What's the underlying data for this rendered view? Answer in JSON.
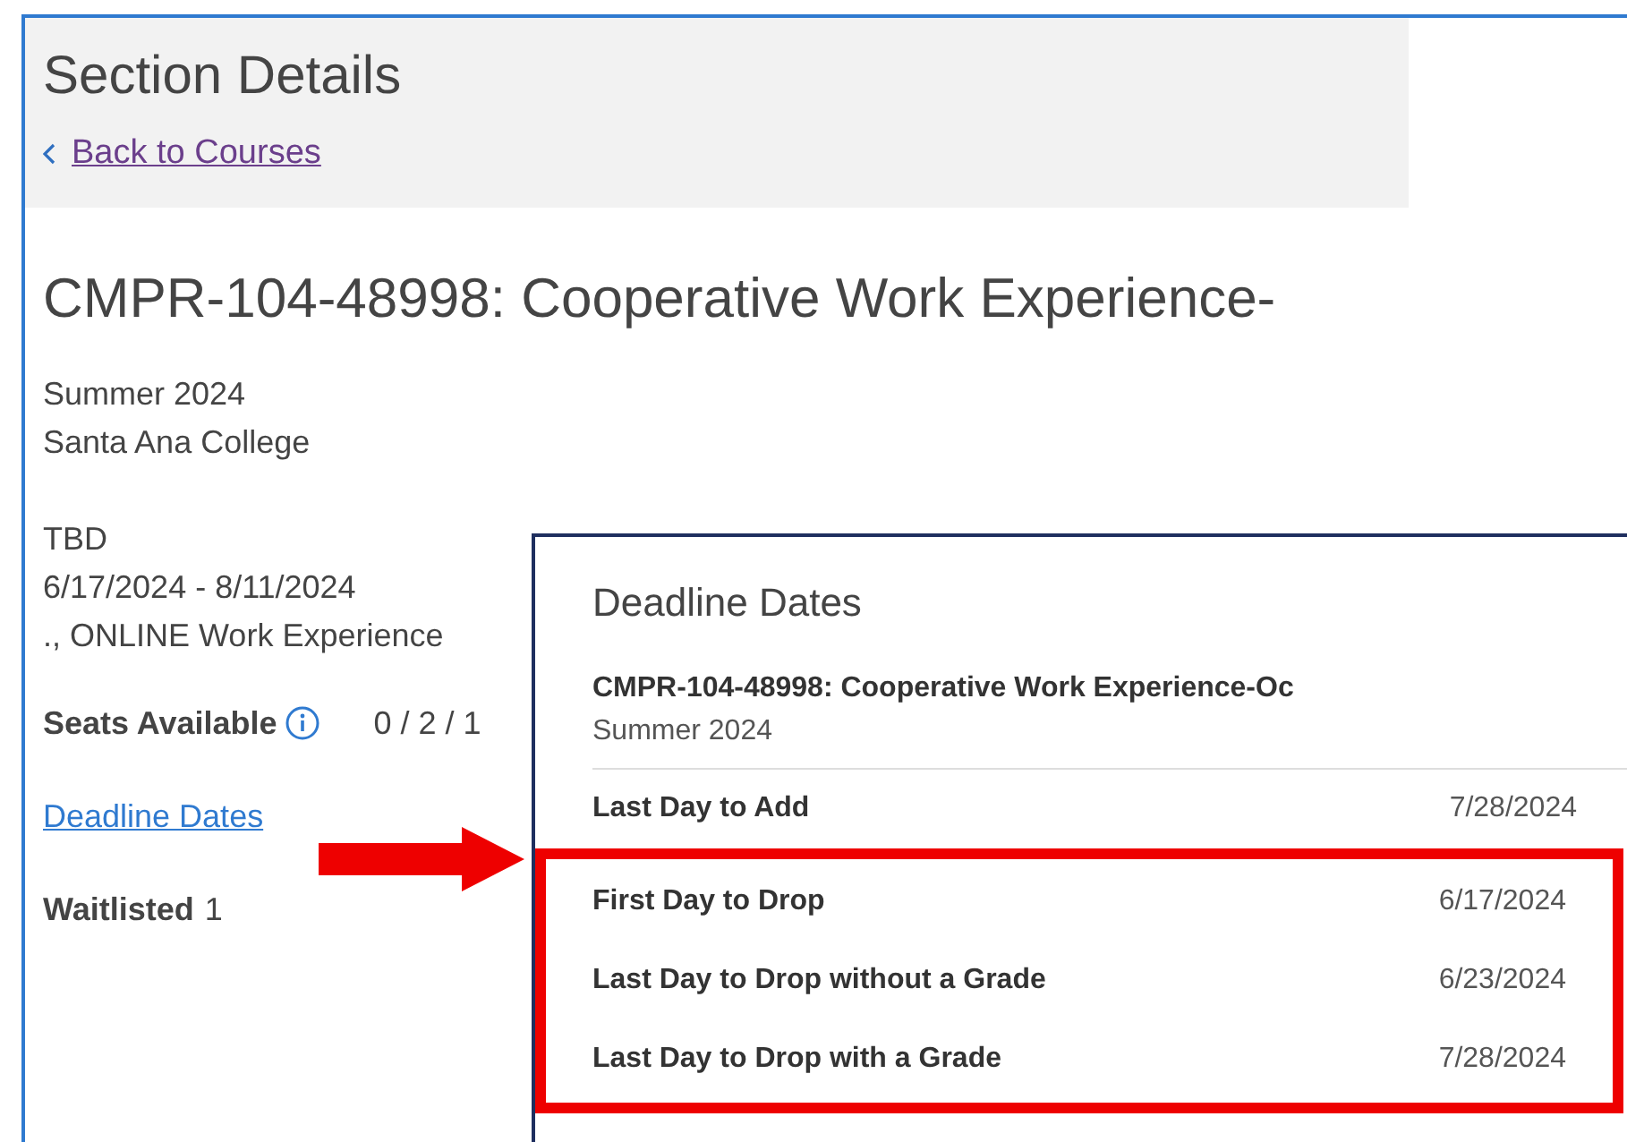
{
  "header": {
    "title": "Section Details",
    "back_link": "Back to Courses"
  },
  "course": {
    "title": "CMPR-104-48998: Cooperative Work Experience-",
    "term": "Summer 2024",
    "campus": "Santa Ana College",
    "time": "TBD",
    "dates": "6/17/2024 - 8/11/2024",
    "location": "., ONLINE Work Experience",
    "seats_label": "Seats Available",
    "seats_value": "0 / 2 / 1",
    "deadline_link": "Deadline Dates",
    "waitlisted_label": "Waitlisted",
    "waitlisted_value": "1"
  },
  "popup": {
    "title": "Deadline Dates",
    "course": "CMPR-104-48998: Cooperative Work Experience-Oc",
    "term": "Summer 2024",
    "rows": [
      {
        "label": "Last Day to Add",
        "date": "7/28/2024",
        "highlighted": false
      },
      {
        "label": "First Day to Drop",
        "date": "6/17/2024",
        "highlighted": true
      },
      {
        "label": "Last Day to Drop without a Grade",
        "date": "6/23/2024",
        "highlighted": true
      },
      {
        "label": "Last Day to Drop with a Grade",
        "date": "7/28/2024",
        "highlighted": true
      }
    ]
  }
}
